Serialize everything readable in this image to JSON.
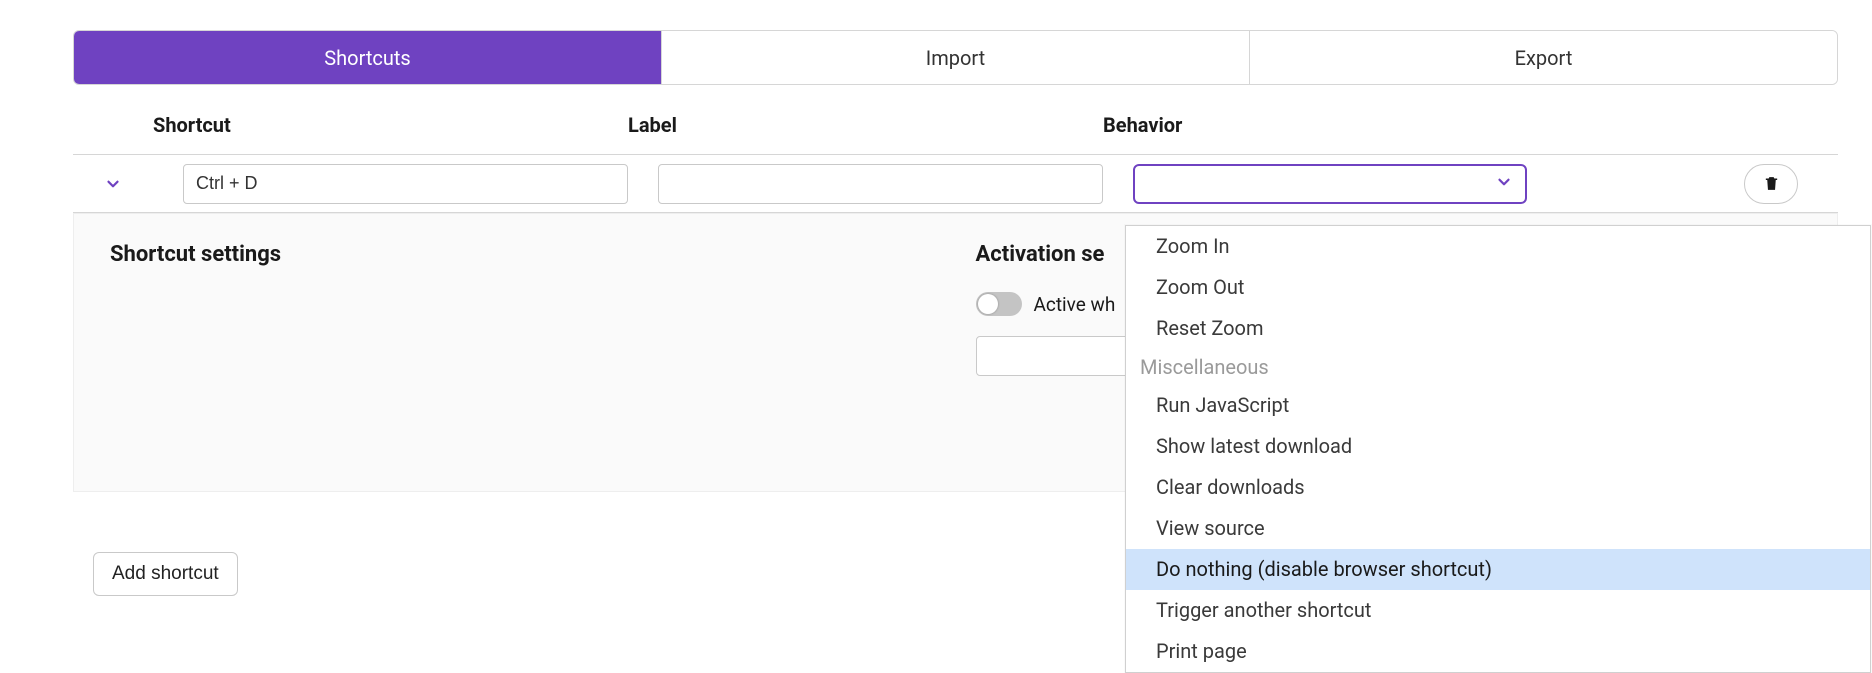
{
  "tabs": {
    "shortcuts": "Shortcuts",
    "import": "Import",
    "export": "Export"
  },
  "headers": {
    "shortcut": "Shortcut",
    "label": "Label",
    "behavior": "Behavior"
  },
  "row": {
    "shortcut_value": "Ctrl + D",
    "label_value": "",
    "behavior_value": ""
  },
  "settings": {
    "shortcut_title": "Shortcut settings",
    "activation_title_prefix": "Activation se",
    "toggle_label_prefix": "Active wh"
  },
  "buttons": {
    "add_shortcut": "Add shortcut"
  },
  "dropdown": {
    "items_leading": [
      "Zoom In",
      "Zoom Out",
      "Reset Zoom"
    ],
    "group_label": "Miscellaneous",
    "items_misc": [
      "Run JavaScript",
      "Show latest download",
      "Clear downloads",
      "View source",
      "Do nothing (disable browser shortcut)",
      "Trigger another shortcut",
      "Print page"
    ],
    "highlighted_index": 4
  }
}
